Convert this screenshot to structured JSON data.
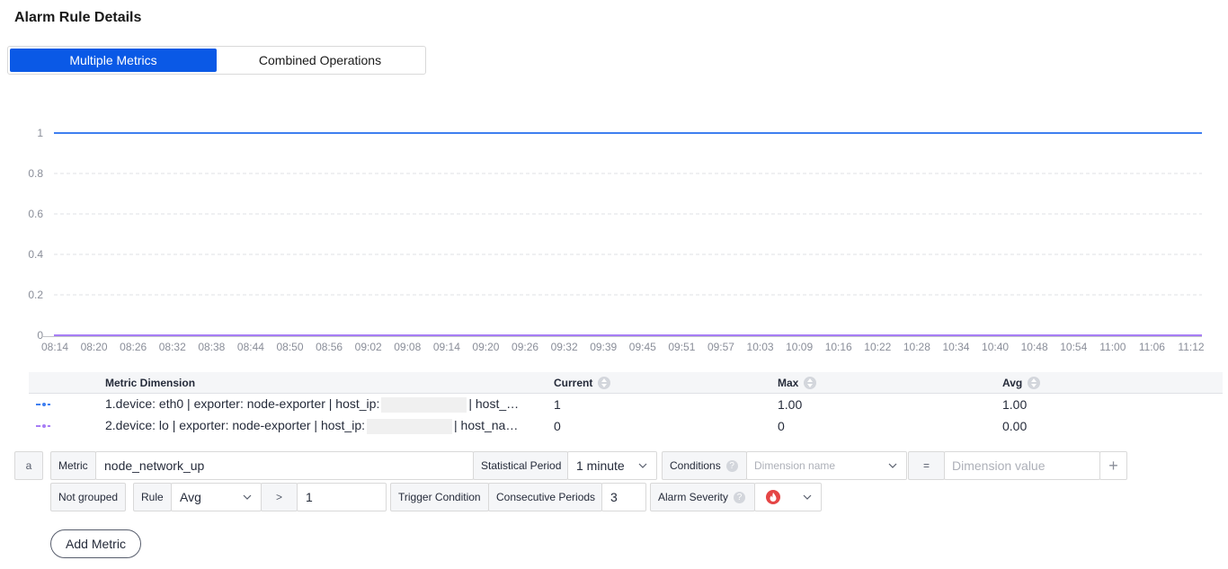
{
  "page_title": "Alarm Rule Details",
  "tabs": {
    "multiple_metrics": "Multiple Metrics",
    "combined_operations": "Combined Operations"
  },
  "chart_data": {
    "type": "line",
    "x": [
      "08:14",
      "08:20",
      "08:26",
      "08:32",
      "08:38",
      "08:44",
      "08:50",
      "08:56",
      "09:02",
      "09:08",
      "09:14",
      "09:20",
      "09:26",
      "09:32",
      "09:39",
      "09:45",
      "09:51",
      "09:57",
      "10:03",
      "10:09",
      "10:16",
      "10:22",
      "10:28",
      "10:34",
      "10:40",
      "10:48",
      "10:54",
      "11:00",
      "11:06",
      "11:12"
    ],
    "y_ticks": [
      "1",
      "0.8",
      "0.6",
      "0.4",
      "0.2",
      "0"
    ],
    "ylim": [
      0,
      1
    ],
    "grid": true,
    "series": [
      {
        "color": "#3f7ff0",
        "values": [
          1,
          1,
          1,
          1,
          1,
          1,
          1,
          1,
          1,
          1,
          1,
          1,
          1,
          1,
          1,
          1,
          1,
          1,
          1,
          1,
          1,
          1,
          1,
          1,
          1,
          1,
          1,
          1,
          1,
          1
        ]
      },
      {
        "color": "#a77df5",
        "values": [
          0,
          0,
          0,
          0,
          0,
          0,
          0,
          0,
          0,
          0,
          0,
          0,
          0,
          0,
          0,
          0,
          0,
          0,
          0,
          0,
          0,
          0,
          0,
          0,
          0,
          0,
          0,
          0,
          0,
          0
        ]
      }
    ]
  },
  "metric_table": {
    "headers": {
      "dimension": "Metric Dimension",
      "current": "Current",
      "max": "Max",
      "avg": "Avg"
    },
    "rows": [
      {
        "color": "#3f7ff0",
        "dim_prefix": "1.device: eth0 | exporter: node-exporter | host_ip:",
        "dim_suffix": "| host_…",
        "current": "1",
        "max": "1.00",
        "avg": "1.00"
      },
      {
        "color": "#a77df5",
        "dim_prefix": "2.device: lo | exporter: node-exporter | host_ip:",
        "dim_suffix": "| host_na…",
        "current": "0",
        "max": "0",
        "avg": "0.00"
      }
    ]
  },
  "rule": {
    "id_label": "a",
    "metric_label": "Metric",
    "metric_value": "node_network_up",
    "stat_period_label": "Statistical Period",
    "stat_period_value": "1 minute",
    "conditions_label": "Conditions",
    "dimension_name_placeholder": "Dimension name",
    "equals": "=",
    "dimension_value_placeholder": "Dimension value",
    "plus": "+",
    "not_grouped": "Not grouped",
    "rule_label": "Rule",
    "rule_value": "Avg",
    "operator": ">",
    "threshold": "1",
    "trigger_condition_label": "Trigger Condition",
    "consecutive_periods_label": "Consecutive Periods",
    "consecutive_periods_value": "3",
    "alarm_severity_label": "Alarm Severity",
    "help": "?"
  },
  "add_metric_label": "Add Metric"
}
